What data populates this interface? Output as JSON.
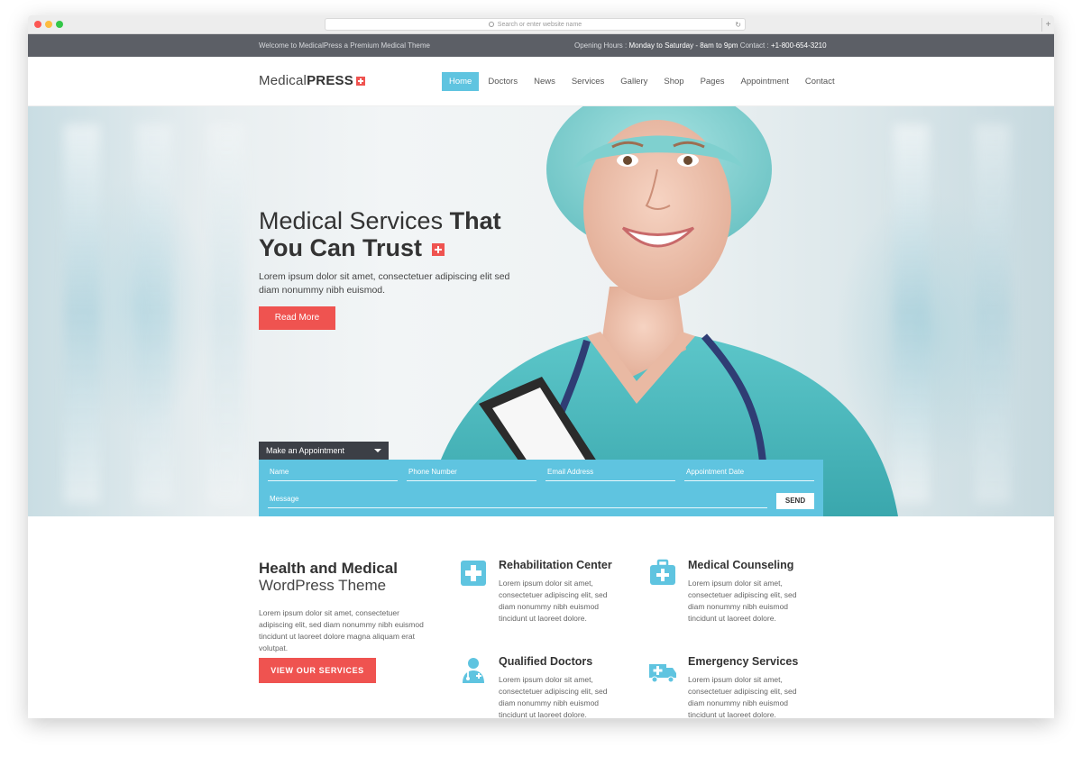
{
  "browser": {
    "url_placeholder": "Search or enter website name",
    "reload_glyph": "↻",
    "new_tab_glyph": "+"
  },
  "topbar": {
    "welcome": "Welcome to MedicalPress a Premium Medical Theme",
    "hours_label": "Opening Hours :",
    "hours_value": "Monday to Saturday - 8am to 9pm",
    "contact_label": "Contact :",
    "contact_value": "+1-800-654-3210"
  },
  "header": {
    "logo_light": "Medical",
    "logo_bold": "PRESS",
    "nav": [
      "Home",
      "Doctors",
      "News",
      "Services",
      "Gallery",
      "Shop",
      "Pages",
      "Appointment",
      "Contact"
    ],
    "active_nav": "Home"
  },
  "hero": {
    "title_light": "Medical Services",
    "title_bold_1": "That",
    "title_bold_2": "You Can Trust",
    "subtitle": "Lorem ipsum dolor sit amet, consectetuer adipiscing elit sed diam nonummy nibh euismod.",
    "cta": "Read More"
  },
  "appointment": {
    "tab_label": "Make an Appointment",
    "fields": {
      "name": "Name",
      "phone": "Phone Number",
      "email": "Email Address",
      "date": "Appointment Date",
      "message": "Message"
    },
    "send": "SEND"
  },
  "intro": {
    "title": "Health and Medical",
    "subtitle": "WordPress Theme",
    "text": "Lorem ipsum dolor sit amet, consectetuer adipiscing elit, sed diam nonummy nibh euismod tincidunt ut laoreet dolore magna aliquam erat volutpat.",
    "button": "VIEW OUR SERVICES"
  },
  "features": [
    {
      "title": "Rehabilitation Center",
      "icon": "medical-cross-icon",
      "text": "Lorem ipsum dolor sit amet, consectetuer adipiscing elit, sed diam nonummy nibh euismod tincidunt ut laoreet dolore."
    },
    {
      "title": "Medical Counseling",
      "icon": "medical-kit-icon",
      "text": "Lorem ipsum dolor sit amet, consectetuer adipiscing elit, sed diam nonummy nibh euismod tincidunt ut laoreet dolore."
    },
    {
      "title": "Qualified Doctors",
      "icon": "doctor-icon",
      "text": "Lorem ipsum dolor sit amet, consectetuer adipiscing elit, sed diam nonummy nibh euismod tincidunt ut laoreet dolore."
    },
    {
      "title": "Emergency Services",
      "icon": "ambulance-icon",
      "text": "Lorem ipsum dolor sit amet, consectetuer adipiscing elit, sed diam nonummy nibh euismod tincidunt ut laoreet dolore."
    }
  ],
  "colors": {
    "accent_blue": "#5fc4e0",
    "accent_red": "#ef5350",
    "topbar_bg": "#5c5f66",
    "text_dark": "#333333"
  }
}
